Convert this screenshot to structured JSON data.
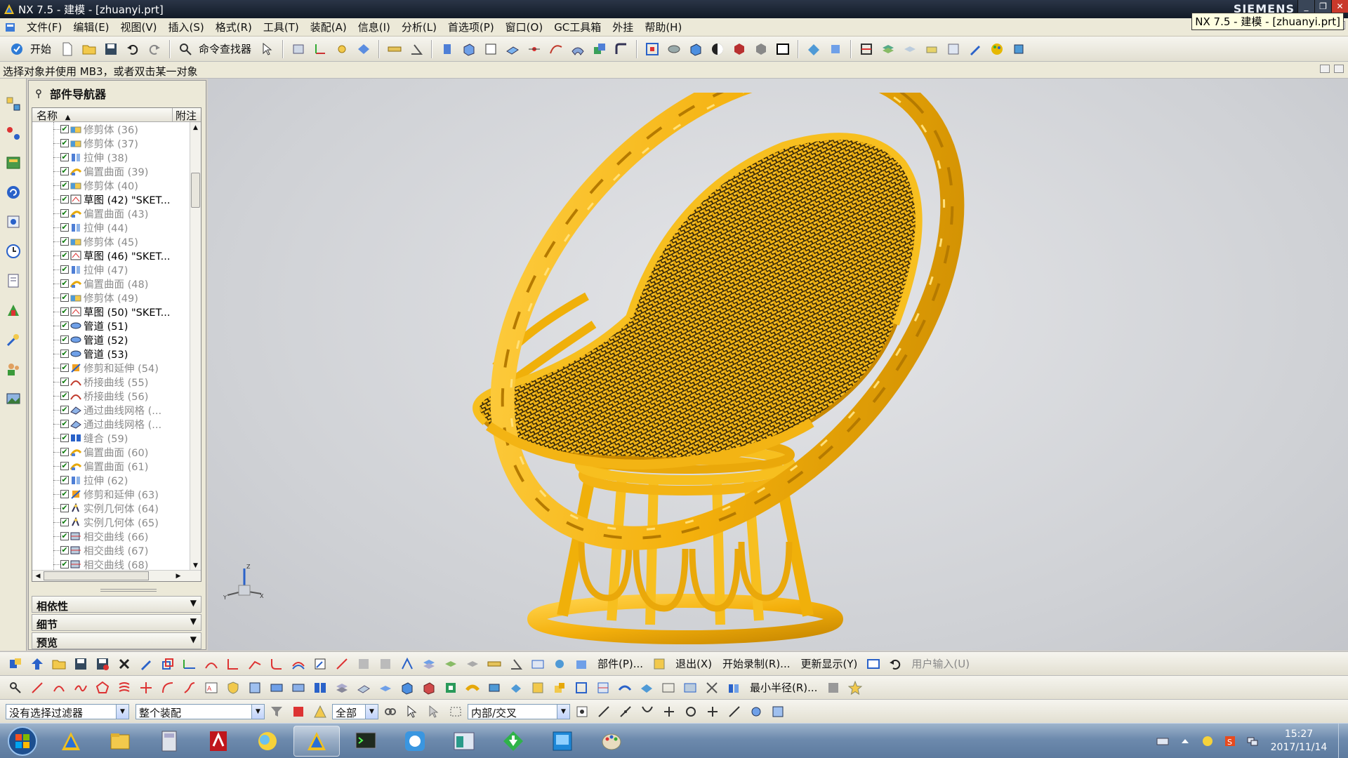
{
  "window": {
    "title": "NX 7.5 - 建模 - [zhuanyi.prt]",
    "brand": "SIEMENS",
    "tooltip": "NX 7.5 - 建模 - [zhuanyi.prt]",
    "minimize": "_",
    "restore": "❐",
    "close": "✕"
  },
  "menu": [
    "文件(F)",
    "编辑(E)",
    "视图(V)",
    "插入(S)",
    "格式(R)",
    "工具(T)",
    "装配(A)",
    "信息(I)",
    "分析(L)",
    "首选项(P)",
    "窗口(O)",
    "GC工具箱",
    "外挂",
    "帮助(H)"
  ],
  "toolbar": {
    "start_label": "开始",
    "command_finder_label": "命令查找器"
  },
  "cue_line": "选择对象并使用 MB3，或者双击某一对象",
  "navigator": {
    "title": "部件导航器",
    "col_name": "名称",
    "col_sort": "▲",
    "col_note": "附注",
    "items": [
      {
        "label": "修剪体 (36)",
        "icon": "trim-body-icon",
        "dim": true
      },
      {
        "label": "修剪体 (37)",
        "icon": "trim-body-icon",
        "dim": true
      },
      {
        "label": "拉伸 (38)",
        "icon": "extrude-icon",
        "dim": true
      },
      {
        "label": "偏置曲面 (39)",
        "icon": "offset-surface-icon",
        "dim": true
      },
      {
        "label": "修剪体 (40)",
        "icon": "trim-body-icon",
        "dim": true
      },
      {
        "label": "草图 (42) \"SKET...",
        "icon": "sketch-icon",
        "dim": false
      },
      {
        "label": "偏置曲面 (43)",
        "icon": "offset-surface-icon",
        "dim": true
      },
      {
        "label": "拉伸 (44)",
        "icon": "extrude-icon",
        "dim": true
      },
      {
        "label": "修剪体 (45)",
        "icon": "trim-body-icon",
        "dim": true
      },
      {
        "label": "草图 (46) \"SKET...",
        "icon": "sketch-icon",
        "dim": false
      },
      {
        "label": "拉伸 (47)",
        "icon": "extrude-icon",
        "dim": true
      },
      {
        "label": "偏置曲面 (48)",
        "icon": "offset-surface-icon",
        "dim": true
      },
      {
        "label": "修剪体 (49)",
        "icon": "trim-body-icon",
        "dim": true
      },
      {
        "label": "草图 (50) \"SKET...",
        "icon": "sketch-icon",
        "dim": false
      },
      {
        "label": "管道 (51)",
        "icon": "tube-icon",
        "dim": false
      },
      {
        "label": "管道 (52)",
        "icon": "tube-icon",
        "dim": false
      },
      {
        "label": "管道 (53)",
        "icon": "tube-icon",
        "dim": false
      },
      {
        "label": "修剪和延伸 (54)",
        "icon": "trim-extend-icon",
        "dim": true
      },
      {
        "label": "桥接曲线 (55)",
        "icon": "bridge-curve-icon",
        "dim": true
      },
      {
        "label": "桥接曲线 (56)",
        "icon": "bridge-curve-icon",
        "dim": true
      },
      {
        "label": "通过曲线网格 (...",
        "icon": "curve-mesh-icon",
        "dim": true
      },
      {
        "label": "通过曲线网格 (...",
        "icon": "curve-mesh-icon",
        "dim": true
      },
      {
        "label": "缝合 (59)",
        "icon": "sew-icon",
        "dim": true
      },
      {
        "label": "偏置曲面 (60)",
        "icon": "offset-surface-icon",
        "dim": true
      },
      {
        "label": "偏置曲面 (61)",
        "icon": "offset-surface-icon",
        "dim": true
      },
      {
        "label": "拉伸 (62)",
        "icon": "extrude-icon",
        "dim": true
      },
      {
        "label": "修剪和延伸 (63)",
        "icon": "trim-extend-icon",
        "dim": true
      },
      {
        "label": "实例几何体 (64)",
        "icon": "instance-geometry-icon",
        "dim": true
      },
      {
        "label": "实例几何体 (65)",
        "icon": "instance-geometry-icon",
        "dim": true
      },
      {
        "label": "相交曲线 (66)",
        "icon": "intersect-curve-icon",
        "dim": true
      },
      {
        "label": "相交曲线 (67)",
        "icon": "intersect-curve-icon",
        "dim": true
      },
      {
        "label": "相交曲线 (68)",
        "icon": "intersect-curve-icon",
        "dim": true
      }
    ],
    "sections": [
      "相依性",
      "细节",
      "预览"
    ]
  },
  "bottom_toolbar": {
    "part_label": "部件(P)...",
    "exit_label": "退出(X)",
    "record_label": "开始录制(R)...",
    "refresh_label": "更新显示(Y)",
    "user_input_label": "用户输入(U)",
    "min_radius_label": "最小半径(R)..."
  },
  "selection_bar": {
    "filter_value": "没有选择过滤器",
    "scope_value": "整个装配",
    "type_value": "全部",
    "mode_value": "内部/交叉"
  },
  "taskbar": {
    "time": "15:27",
    "date": "2017/11/14"
  },
  "colors": {
    "model": "#f7b90f",
    "model_dark": "#b57a00",
    "graphics_bg": "#d6d8db",
    "checkbox": "#0a7a0a"
  }
}
